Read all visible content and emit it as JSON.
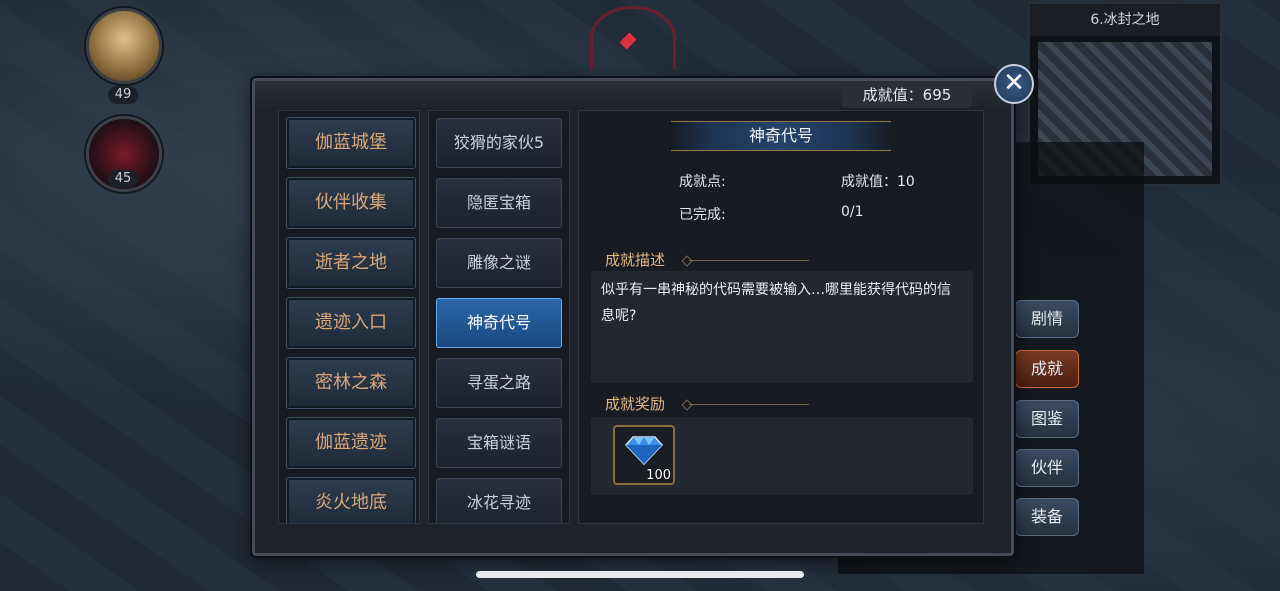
{
  "party": [
    {
      "level": "49"
    },
    {
      "level": "45"
    }
  ],
  "minimap": {
    "title": "6.冰封之地"
  },
  "side_menu": [
    {
      "label": "剧情",
      "active": false
    },
    {
      "label": "成就",
      "active": true
    },
    {
      "label": "图鉴",
      "active": false
    },
    {
      "label": "伙伴",
      "active": false
    },
    {
      "label": "装备",
      "active": false
    }
  ],
  "dialog": {
    "score_label": "成就值：695",
    "close_icon": "close-icon",
    "categories": [
      "伽蓝城堡",
      "伙伴收集",
      "逝者之地",
      "遗迹入口",
      "密林之森",
      "伽蓝遗迹",
      "炎火地底"
    ],
    "achievements": [
      "狡猾的家伙5",
      "隐匿宝箱",
      "雕像之谜",
      "神奇代号",
      "寻蛋之路",
      "宝箱谜语",
      "冰花寻迹"
    ],
    "selected_achievement": "神奇代号",
    "detail": {
      "title": "神奇代号",
      "points_label": "成就点:",
      "points_value": "成就值：10",
      "completed_label": "已完成:",
      "completed_value": "0/1",
      "desc_title": "成就描述",
      "desc_text": "似乎有一串神秘的代码需要被输入…哪里能获得代码的信息呢?",
      "reward_title": "成就奖励",
      "reward_item": {
        "icon": "diamond-icon",
        "count": "100"
      }
    }
  }
}
